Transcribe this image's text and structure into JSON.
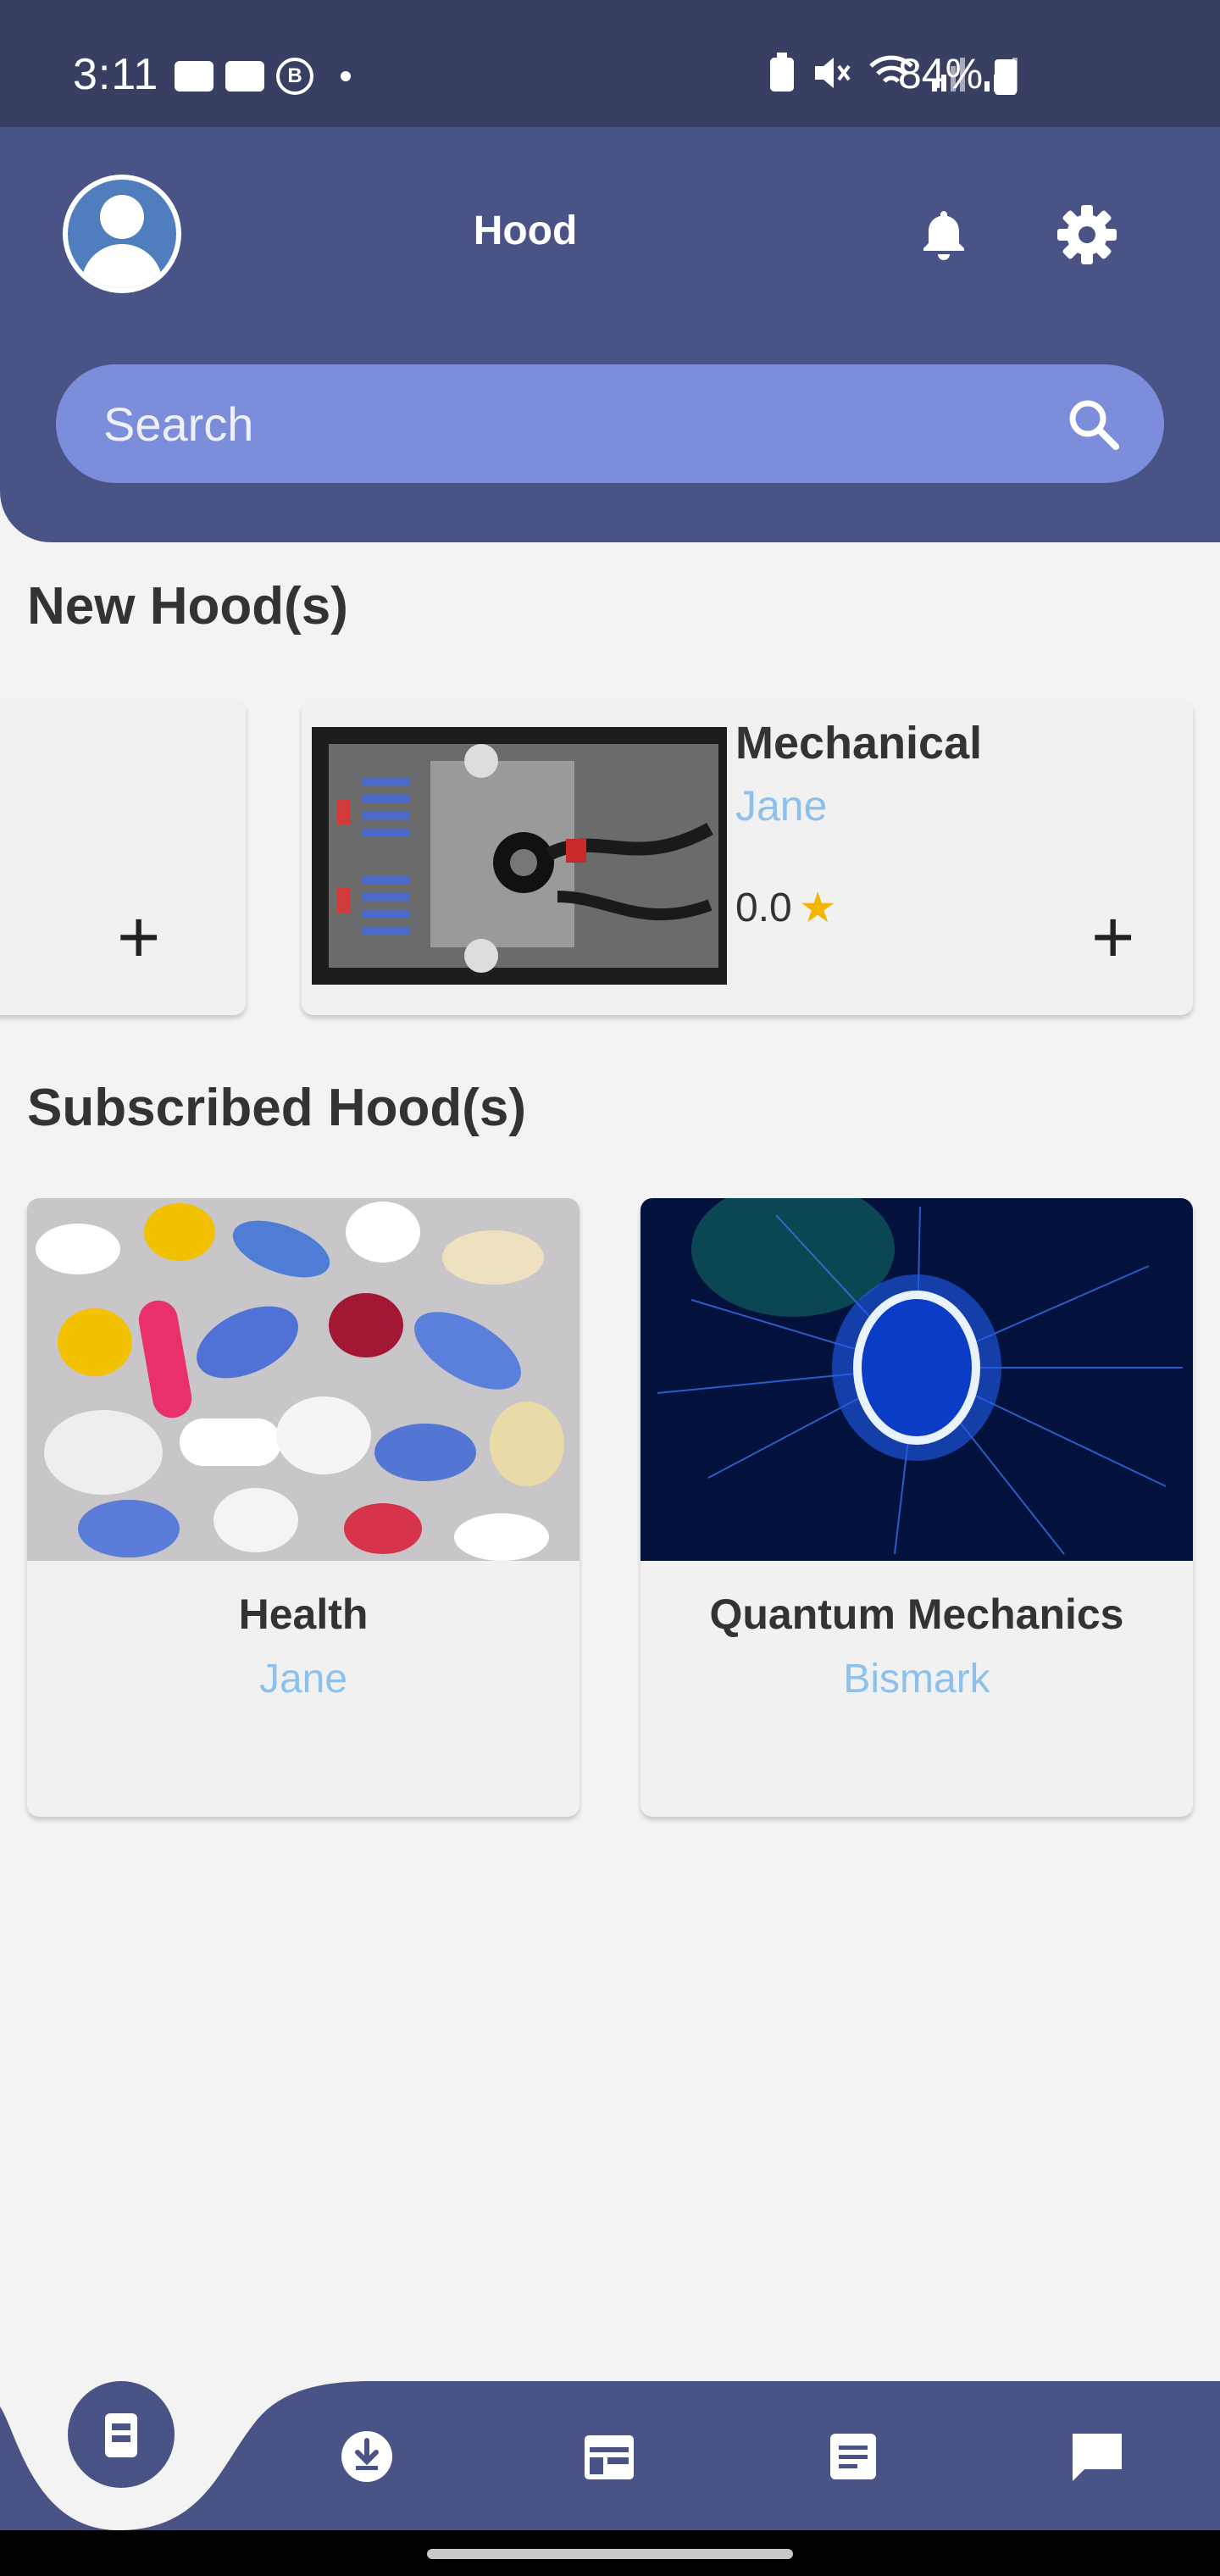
{
  "status_bar": {
    "time": "3:11",
    "battery": "84%",
    "icons": [
      "youtube-icon",
      "gallery-icon",
      "b-icon",
      "dot-icon",
      "battery-saver-icon",
      "mute-icon",
      "wifi-icon",
      "signal-icon",
      "signal-icon",
      "battery-icon"
    ]
  },
  "header": {
    "title": "Hood",
    "search_placeholder": "Search"
  },
  "new_hoods": {
    "title": "New Hood(s)",
    "items": [
      {
        "name": "Mechanical",
        "owner": "Jane",
        "rating": "0.0",
        "add_label": "+"
      }
    ],
    "partial_add_label": "+"
  },
  "subscribed_hoods": {
    "title": "Subscribed Hood(s)",
    "items": [
      {
        "name": "Health",
        "owner": "Jane"
      },
      {
        "name": "Quantum Mechanics",
        "owner": "Bismark"
      }
    ]
  },
  "bottom_nav": {
    "items": [
      "home-icon",
      "download-icon",
      "calendar-icon",
      "notes-icon",
      "chat-icon"
    ]
  },
  "colors": {
    "header": "#4a5385",
    "status_bar": "#383f62",
    "search": "#7b8ddb",
    "owner_link": "#8dc1ec",
    "star": "#f4b400"
  }
}
